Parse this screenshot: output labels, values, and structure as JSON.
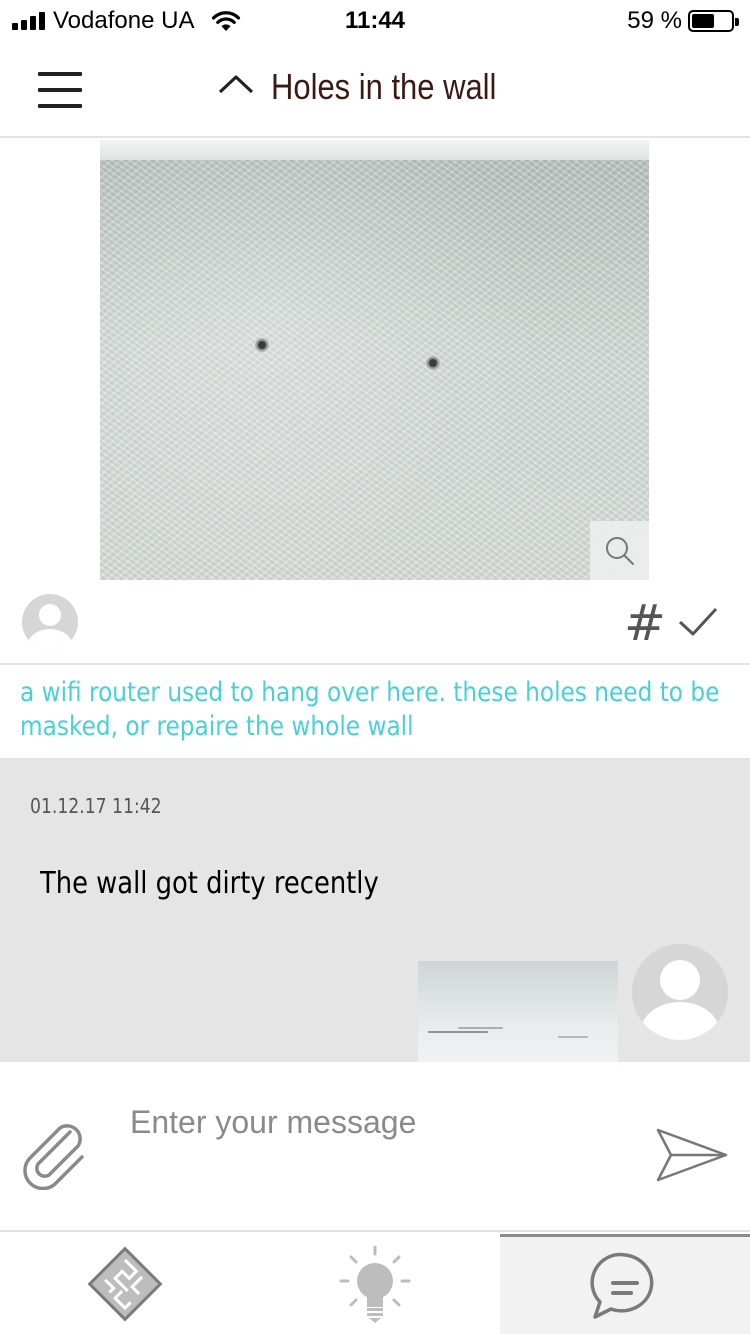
{
  "status_bar": {
    "carrier": "Vodafone UA",
    "time": "11:44",
    "battery_percent": "59 %",
    "battery_level": 0.59,
    "signal_icon": "signal-bars-icon",
    "wifi_icon": "wifi-icon"
  },
  "header": {
    "title": "Holes in the wall",
    "menu_icon": "hamburger-menu-icon",
    "collapse_icon": "chevron-up-icon"
  },
  "post": {
    "photo_alt": "",
    "zoom_icon": "magnifier-icon",
    "hashtag": "#",
    "description": "a wifi router used to hang over here. these holes need to be masked, or repaire the whole wall"
  },
  "comment": {
    "timestamp": "01.12.17 11:42",
    "text": "The wall got dirty recently"
  },
  "composer": {
    "placeholder": "Enter your message",
    "attach_icon": "paperclip-icon",
    "send_icon": "send-icon"
  },
  "tabs": [
    {
      "icon": "floor-plan-icon",
      "active": false
    },
    {
      "icon": "lightbulb-icon",
      "active": false
    },
    {
      "icon": "chat-bubble-icon",
      "active": true
    }
  ],
  "colors": {
    "accent_text": "#4bcfd6",
    "title_text": "#3a1a14",
    "comment_bg": "#e5e5e5",
    "avatar_gray": "#d6d6d6"
  }
}
